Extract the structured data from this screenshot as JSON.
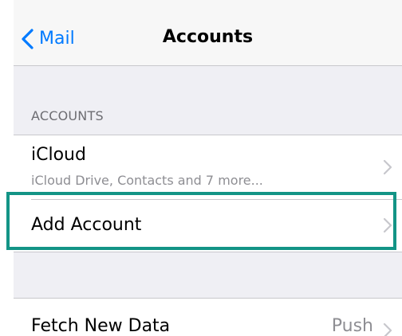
{
  "navbar": {
    "back_label": "Mail",
    "title": "Accounts"
  },
  "accounts_section": {
    "header": "ACCOUNTS",
    "icloud": {
      "title": "iCloud",
      "subtitle": "iCloud Drive, Contacts and 7 more..."
    },
    "add_account": {
      "title": "Add Account"
    }
  },
  "fetch_section": {
    "title": "Fetch New Data",
    "value": "Push"
  },
  "colors": {
    "accent": "#007aff",
    "highlight": "#139486",
    "background": "#efeff4"
  },
  "icons": {
    "back": "chevron-left-icon",
    "disclosure": "chevron-right-icon"
  }
}
